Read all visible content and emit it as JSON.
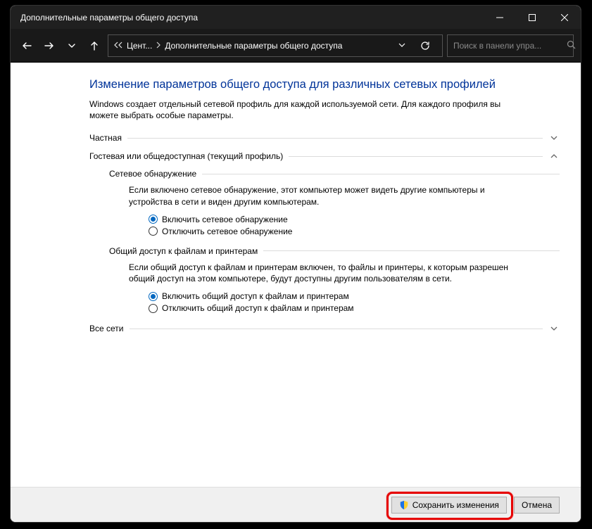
{
  "titlebar": {
    "title": "Дополнительные параметры общего доступа"
  },
  "nav": {
    "crumb1": "Цент...",
    "crumb2": "Дополнительные параметры общего доступа",
    "search_placeholder": "Поиск в панели упра..."
  },
  "page": {
    "title": "Изменение параметров общего доступа для различных сетевых профилей",
    "desc": "Windows создает отдельный сетевой профиль для каждой используемой сети. Для каждого профиля вы можете выбрать особые параметры."
  },
  "sections": {
    "private": {
      "label": "Частная"
    },
    "guest": {
      "label": "Гостевая или общедоступная (текущий профиль)",
      "discovery": {
        "head": "Сетевое обнаружение",
        "desc": "Если включено сетевое обнаружение, этот компьютер может видеть другие компьютеры и устройства в сети и виден другим компьютерам.",
        "opt_on": "Включить сетевое обнаружение",
        "opt_off": "Отключить сетевое обнаружение"
      },
      "fileshare": {
        "head": "Общий доступ к файлам и принтерам",
        "desc": "Если общий доступ к файлам и принтерам включен, то файлы и принтеры, к которым разрешен общий доступ на этом компьютере, будут доступны другим пользователям в сети.",
        "opt_on": "Включить общий доступ к файлам и принтерам",
        "opt_off": "Отключить общий доступ к файлам и принтерам"
      }
    },
    "all": {
      "label": "Все сети"
    }
  },
  "footer": {
    "save": "Сохранить изменения",
    "cancel": "Отмена"
  }
}
